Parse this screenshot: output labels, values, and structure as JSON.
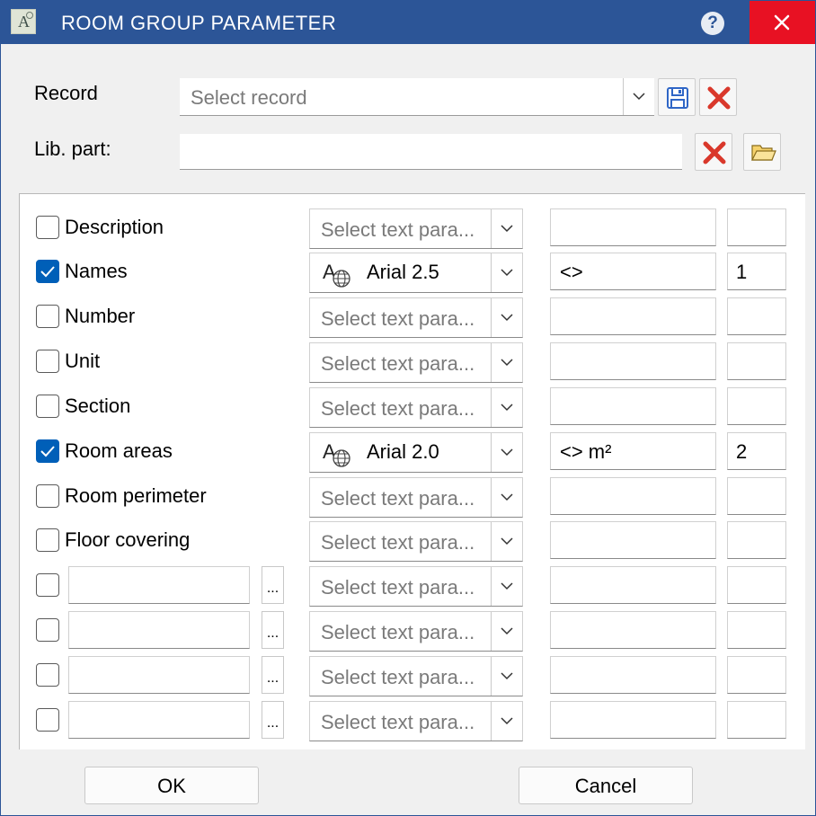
{
  "window": {
    "title": "ROOM GROUP PARAMETER",
    "app_icon_letter": "A",
    "help_label": "?"
  },
  "record": {
    "label": "Record",
    "placeholder": "Select record"
  },
  "lib_part": {
    "label": "Lib. part:",
    "value": ""
  },
  "rows": [
    {
      "label": "Description",
      "checked": false,
      "text_param": "",
      "text_placeholder": "Select text para...",
      "prefix": "",
      "number": ""
    },
    {
      "label": "Names",
      "checked": true,
      "text_param": "Arial 2.5",
      "text_placeholder": "",
      "prefix": "<>",
      "number": "1"
    },
    {
      "label": "Number",
      "checked": false,
      "text_param": "",
      "text_placeholder": "Select text para...",
      "prefix": "",
      "number": ""
    },
    {
      "label": "Unit",
      "checked": false,
      "text_param": "",
      "text_placeholder": "Select text para...",
      "prefix": "",
      "number": ""
    },
    {
      "label": "Section",
      "checked": false,
      "text_param": "",
      "text_placeholder": "Select text para...",
      "prefix": "",
      "number": ""
    },
    {
      "label": "Room areas",
      "checked": true,
      "text_param": "Arial 2.0",
      "text_placeholder": "",
      "prefix": "<> m²",
      "number": "2"
    },
    {
      "label": "Room perimeter",
      "checked": false,
      "text_param": "",
      "text_placeholder": "Select text para...",
      "prefix": "",
      "number": ""
    },
    {
      "label": "Floor covering",
      "checked": false,
      "text_param": "",
      "text_placeholder": "Select text para...",
      "prefix": "",
      "number": ""
    }
  ],
  "custom_rows": [
    {
      "checked": false,
      "name": "",
      "ellipsis": "...",
      "text_placeholder": "Select text para...",
      "prefix": "",
      "number": ""
    },
    {
      "checked": false,
      "name": "",
      "ellipsis": "...",
      "text_placeholder": "Select text para...",
      "prefix": "",
      "number": ""
    },
    {
      "checked": false,
      "name": "",
      "ellipsis": "...",
      "text_placeholder": "Select text para...",
      "prefix": "",
      "number": ""
    },
    {
      "checked": false,
      "name": "",
      "ellipsis": "...",
      "text_placeholder": "Select text para...",
      "prefix": "",
      "number": ""
    }
  ],
  "buttons": {
    "ok": "OK",
    "cancel": "Cancel"
  },
  "icons": {
    "save": "save-icon",
    "delete": "delete-x-icon",
    "folder": "open-folder-icon",
    "font": "font-globe-icon",
    "dropdown": "chevron-down-icon"
  },
  "colors": {
    "titlebar": "#2c5597",
    "close": "#e81123",
    "checkbox_checked": "#005fb8",
    "delete_red": "#d9382b"
  }
}
